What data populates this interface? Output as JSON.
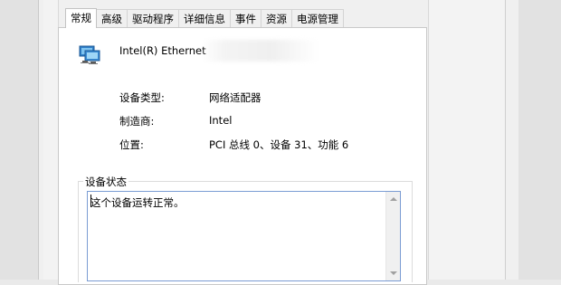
{
  "tabs": [
    {
      "label": "常规",
      "active": true
    },
    {
      "label": "高级"
    },
    {
      "label": "驱动程序"
    },
    {
      "label": "详细信息"
    },
    {
      "label": "事件"
    },
    {
      "label": "资源"
    },
    {
      "label": "电源管理"
    }
  ],
  "device": {
    "icon": "network-adapter-icon",
    "name": "Intel(R) Ethernet"
  },
  "properties": [
    {
      "label": "设备类型:",
      "value": "网络适配器"
    },
    {
      "label": "制造商:",
      "value": "Intel"
    },
    {
      "label": "位置:",
      "value": "PCI 总线 0、设备 31、功能 6"
    }
  ],
  "status": {
    "group_title": "设备状态",
    "text": "这个设备运转正常。"
  },
  "colors": {
    "focus_border": "#7a9cd3",
    "panel_bg": "#ffffff",
    "dialog_bg": "#f0f0f0"
  }
}
